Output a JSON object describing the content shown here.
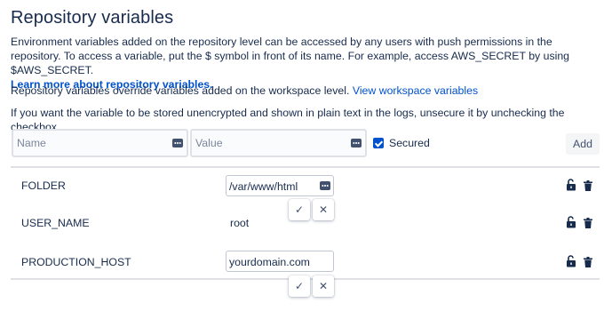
{
  "header": {
    "title": "Repository variables"
  },
  "intro": {
    "text": "Environment variables added on the repository level can be accessed by any users with push permissions in the repository. To access a variable, put the $ symbol in front of its name. For example, access AWS_SECRET by using $AWS_SECRET.",
    "learn_more_link": "Learn more about repository variables."
  },
  "override": {
    "text": "Repository variables override variables added on the workspace level.",
    "link": "View workspace variables"
  },
  "secure_note": {
    "text": "If you want the variable to be stored unencrypted and shown in plain text in the logs, unsecure it by unchecking the checkbox."
  },
  "form": {
    "name_placeholder": "Name",
    "value_placeholder": "Value",
    "secured_label": "Secured",
    "secured_checked": true,
    "add_label": "Add"
  },
  "variables": [
    {
      "name": "FOLDER",
      "value": "/var/www/html",
      "editing": true
    },
    {
      "name": "USER_NAME",
      "value": "root",
      "editing": false
    },
    {
      "name": "PRODUCTION_HOST",
      "value": "yourdomain.com",
      "editing": true
    }
  ],
  "row_actions": {
    "confirm_symbol": "✓",
    "cancel_symbol": "✕"
  },
  "icons": [
    "keyboard-icon",
    "unlock-icon",
    "trash-icon",
    "check-icon",
    "close-icon"
  ],
  "colors": {
    "link": "#0052cc",
    "text": "#172b4d",
    "checkbox": "#0052cc",
    "divider": "#dfe1e6"
  }
}
